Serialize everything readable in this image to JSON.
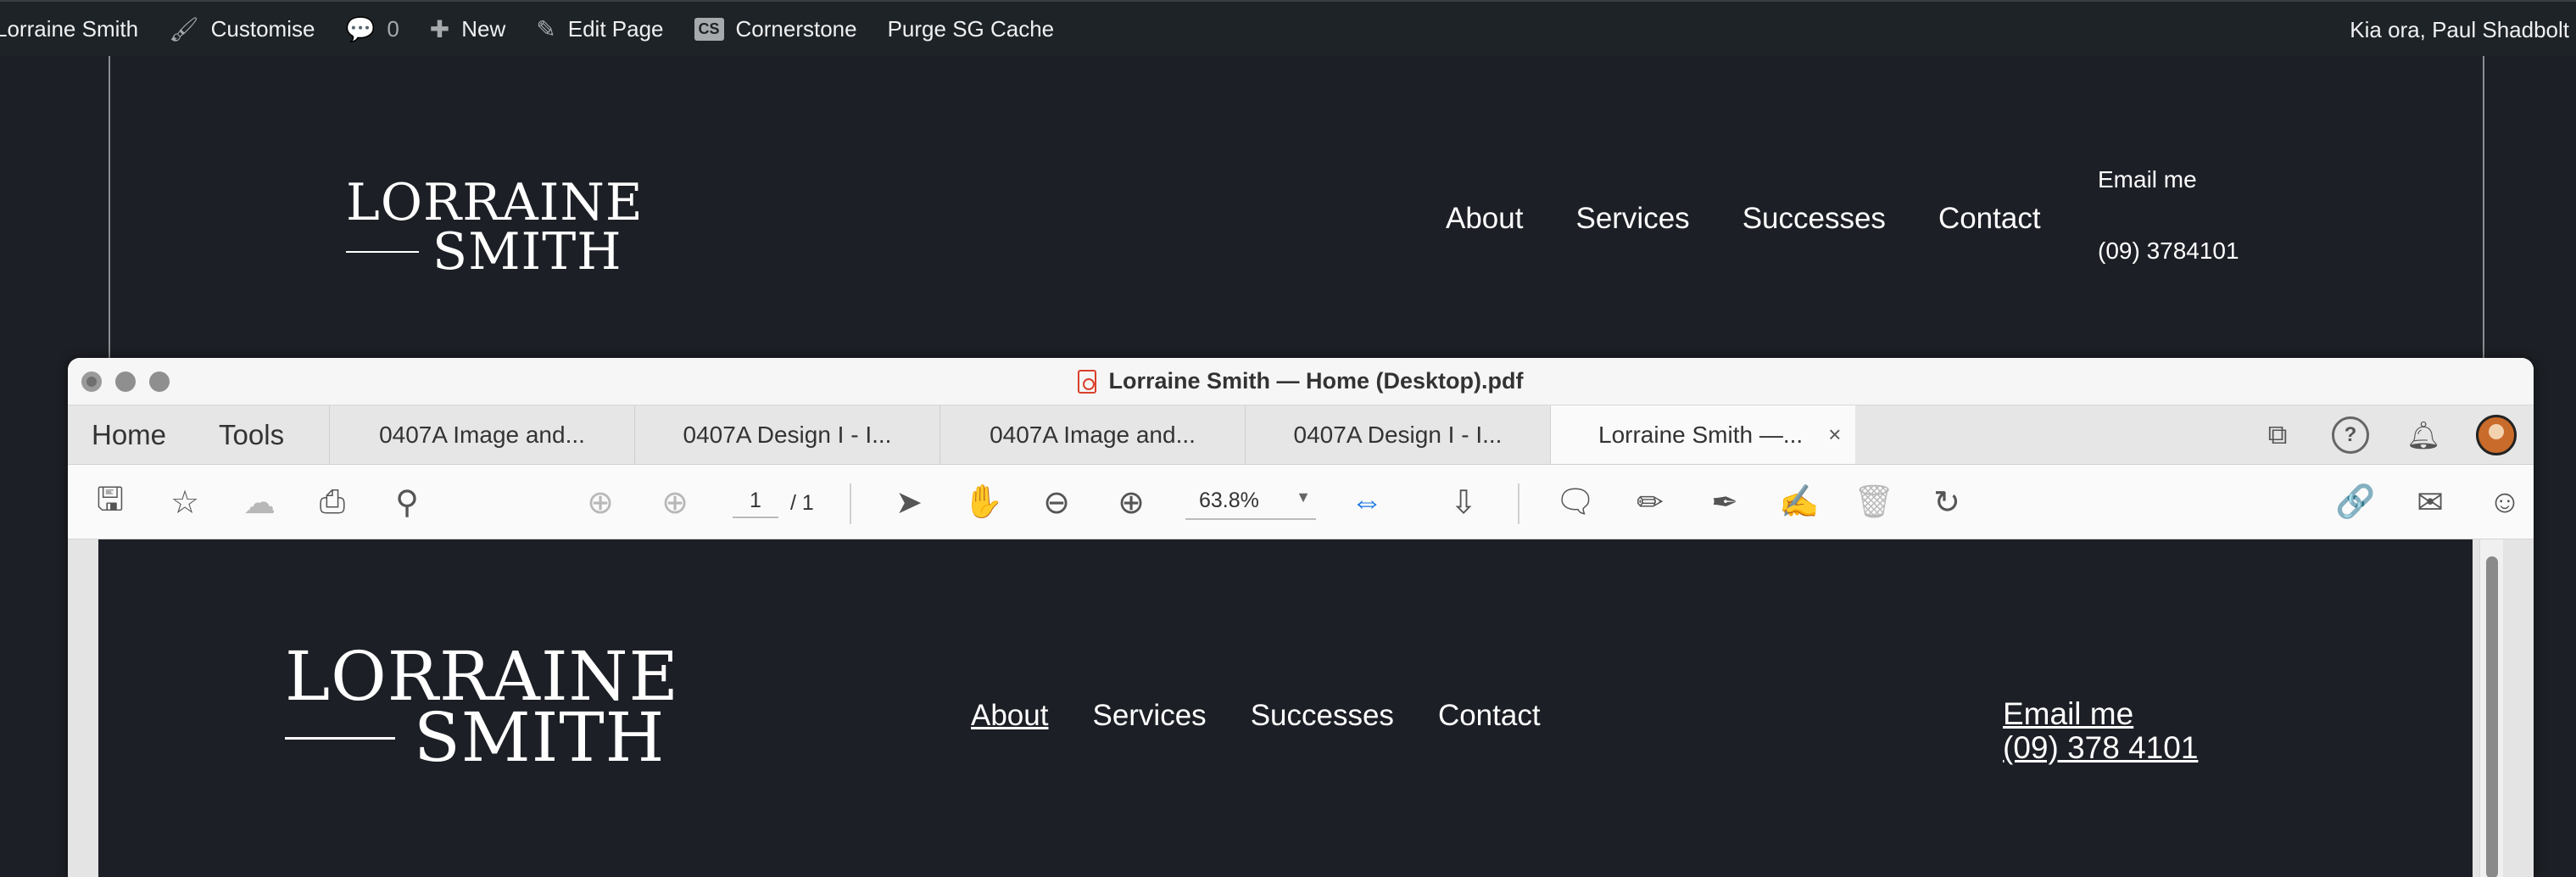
{
  "adminbar": {
    "site_name": "Lorraine Smith",
    "customise": "Customise",
    "comments_count": "0",
    "new": "New",
    "edit_page": "Edit Page",
    "cornerstone": "Cornerstone",
    "cornerstone_badge": "CS",
    "purge": "Purge SG Cache",
    "greeting": "Kia ora, Paul Shadbolt"
  },
  "site": {
    "logo_line1": "LORRAINE",
    "logo_line2": "SMITH",
    "nav": [
      "About",
      "Services",
      "Successes",
      "Contact"
    ],
    "email": "Email me",
    "phone": "(09) 3784101"
  },
  "window": {
    "title": "Lorraine Smith — Home (Desktop).pdf",
    "menu": [
      "Home",
      "Tools"
    ],
    "tabs": [
      "0407A Image and...",
      "0407A Design I - I...",
      "0407A Image and...",
      "0407A Design I - I...",
      "Lorraine Smith —..."
    ],
    "tab_close": "×"
  },
  "toolbar": {
    "page_current": "1",
    "page_total": "/ 1",
    "zoom": "63.8%"
  },
  "pdf_page": {
    "logo_line1": "LORRAINE",
    "logo_line2": "SMITH",
    "nav": [
      "About",
      "Services",
      "Successes",
      "Contact"
    ],
    "email": "Email me",
    "phone": "(09) 378 4101"
  },
  "icons": {
    "customise": "brush-icon",
    "comments": "comment-icon",
    "new": "plus-icon",
    "edit": "pencil-icon"
  }
}
